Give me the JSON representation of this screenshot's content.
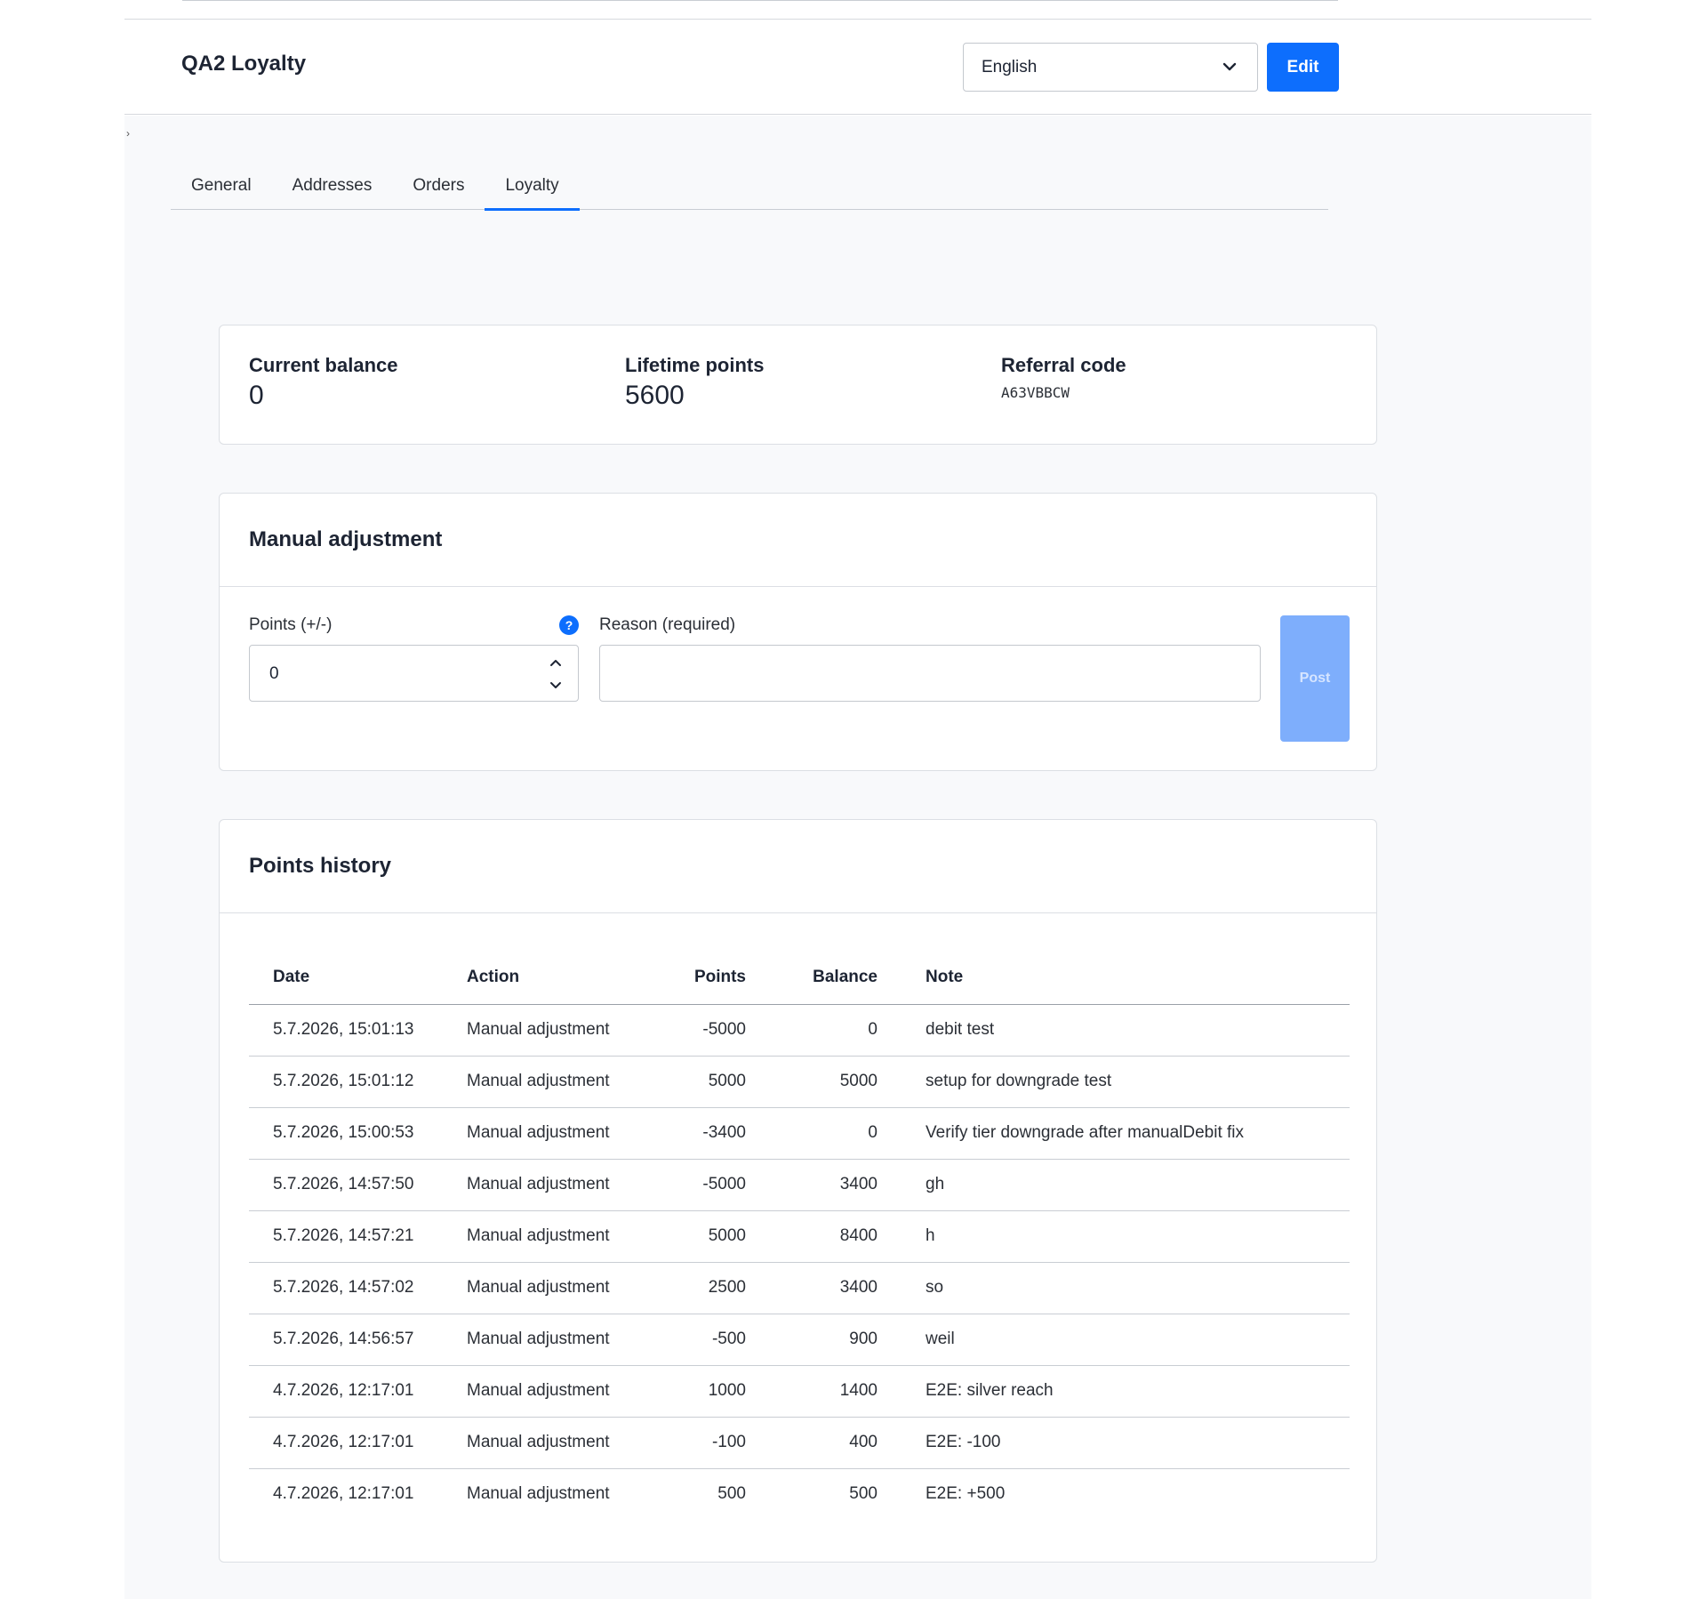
{
  "page": {
    "title": "QA2 Loyalty"
  },
  "header": {
    "language": "English",
    "edit_label": "Edit"
  },
  "tabs": [
    {
      "label": "General"
    },
    {
      "label": "Addresses"
    },
    {
      "label": "Orders"
    },
    {
      "label": "Loyalty",
      "active": true
    }
  ],
  "stats": {
    "current_balance_label": "Current balance",
    "current_balance_value": "0",
    "lifetime_points_label": "Lifetime points",
    "lifetime_points_value": "5600",
    "referral_code_label": "Referral code",
    "referral_code_value": "A63VBBCW"
  },
  "adjustment": {
    "title": "Manual adjustment",
    "points_label": "Points (+/-)",
    "points_value": "0",
    "help_icon": "?",
    "reason_label": "Reason (required)",
    "reason_value": "",
    "post_label": "Post"
  },
  "history": {
    "title": "Points history",
    "columns": [
      "Date",
      "Action",
      "Points",
      "Balance",
      "Note"
    ],
    "rows": [
      {
        "date": "5.7.2026, 15:01:13",
        "action": "Manual adjustment",
        "points": "-5000",
        "balance": "0",
        "note": "debit test"
      },
      {
        "date": "5.7.2026, 15:01:12",
        "action": "Manual adjustment",
        "points": "5000",
        "balance": "5000",
        "note": "setup for downgrade test"
      },
      {
        "date": "5.7.2026, 15:00:53",
        "action": "Manual adjustment",
        "points": "-3400",
        "balance": "0",
        "note": "Verify tier downgrade after manualDebit fix"
      },
      {
        "date": "5.7.2026, 14:57:50",
        "action": "Manual adjustment",
        "points": "-5000",
        "balance": "3400",
        "note": "gh"
      },
      {
        "date": "5.7.2026, 14:57:21",
        "action": "Manual adjustment",
        "points": "5000",
        "balance": "8400",
        "note": "h"
      },
      {
        "date": "5.7.2026, 14:57:02",
        "action": "Manual adjustment",
        "points": "2500",
        "balance": "3400",
        "note": "so"
      },
      {
        "date": "5.7.2026, 14:56:57",
        "action": "Manual adjustment",
        "points": "-500",
        "balance": "900",
        "note": "weil"
      },
      {
        "date": "4.7.2026, 12:17:01",
        "action": "Manual adjustment",
        "points": "1000",
        "balance": "1400",
        "note": "E2E: silver reach"
      },
      {
        "date": "4.7.2026, 12:17:01",
        "action": "Manual adjustment",
        "points": "-100",
        "balance": "400",
        "note": "E2E: -100"
      },
      {
        "date": "4.7.2026, 12:17:01",
        "action": "Manual adjustment",
        "points": "500",
        "balance": "500",
        "note": "E2E: +500"
      }
    ]
  },
  "colors": {
    "accent": "#0d6efd",
    "post_disabled": "#7eaefc",
    "content_bg": "#f8f9fb"
  },
  "icons": {
    "language_select": "chevron-down-icon",
    "points_spinner": [
      "chevron-up-icon",
      "chevron-down-icon"
    ],
    "help": "help-icon"
  }
}
